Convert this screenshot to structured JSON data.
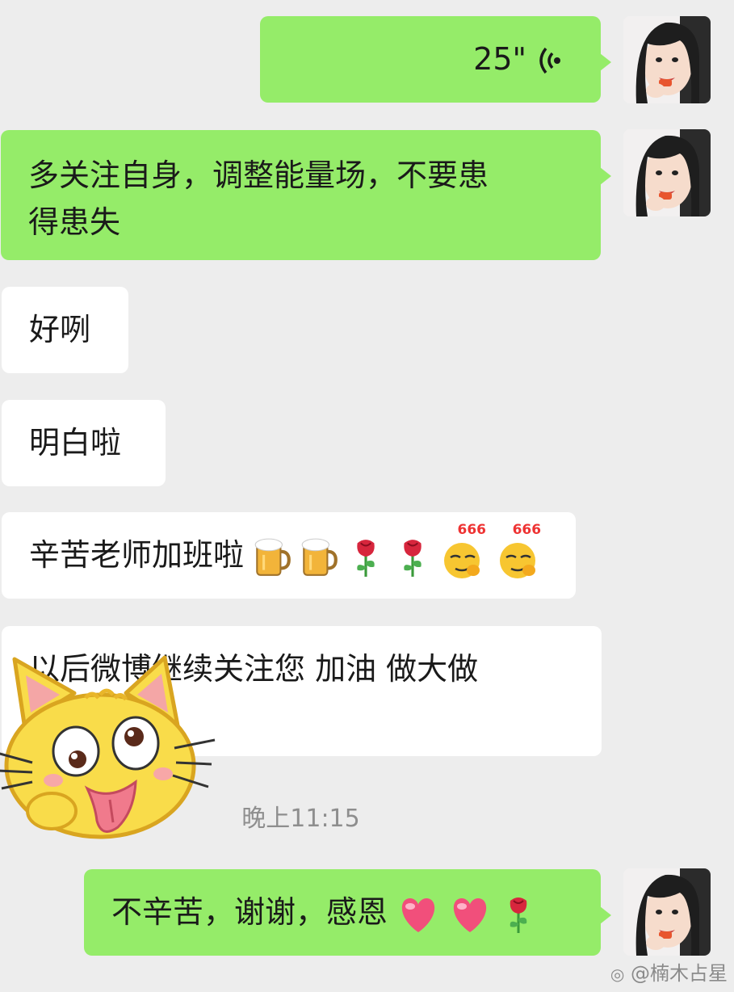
{
  "messages": [
    {
      "voice_duration": "25\"",
      "icon": "voice-wave-icon"
    },
    {
      "text_line1": "多关注自身，调整能量场，不要患",
      "text_line2": "得患失"
    },
    {
      "text": "好咧"
    },
    {
      "text": "明白啦"
    },
    {
      "text": "辛苦老师加班啦",
      "emojis": [
        "beer-icon",
        "beer-icon",
        "rose-icon",
        "rose-icon",
        "666-emoji-icon",
        "666-emoji-icon"
      ],
      "emoji_badge": "666"
    },
    {
      "text": "以后微博继续关注您 加油 做大做"
    },
    {
      "text": "不辛苦，谢谢，感恩",
      "emojis": [
        "heart-icon",
        "heart-icon",
        "rose-icon"
      ]
    }
  ],
  "timestamp": "晚上11:15",
  "watermark": "@楠木占星",
  "colors": {
    "background": "#ededed",
    "bubble_self": "#95ec69",
    "bubble_other": "#ffffff"
  },
  "sticker": "cat-tongue-sticker"
}
